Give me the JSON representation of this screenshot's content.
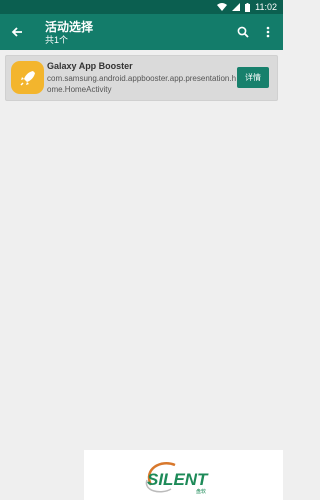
{
  "status_bar": {
    "time": "11:02"
  },
  "app_bar": {
    "title": "活动选择",
    "subtitle": "共1个"
  },
  "activities": [
    {
      "name": "Galaxy App Booster",
      "package": "com.samsung.android.appbooster.app.presentation.home.HomeActivity",
      "details_label": "详情"
    }
  ],
  "watermark": {
    "text": "SILENT",
    "subtext": "盘软"
  },
  "colors": {
    "primary": "#137c6a",
    "status_bar": "#0b5f50",
    "accent_button": "#17806c",
    "app_icon_bg": "#f3b52d"
  },
  "icons": [
    "wifi-icon",
    "signal-icon",
    "battery-icon",
    "back-arrow-icon",
    "search-icon",
    "more-vert-icon",
    "rocket-icon"
  ]
}
